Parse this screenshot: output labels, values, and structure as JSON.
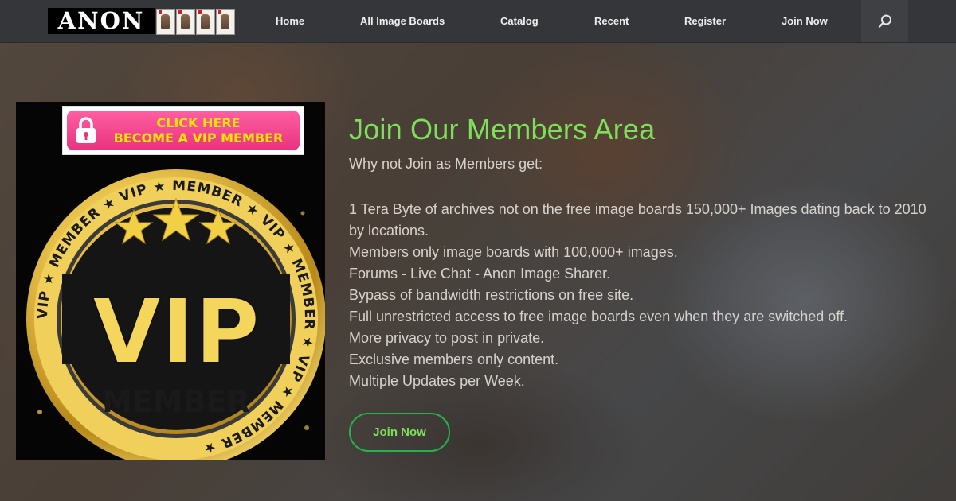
{
  "brand": {
    "logo_text": "ANON",
    "logo_cards_icon": "playing-cards-icon"
  },
  "nav": {
    "items": [
      {
        "label": "Home"
      },
      {
        "label": "All Image Boards"
      },
      {
        "label": "Catalog"
      },
      {
        "label": "Recent"
      },
      {
        "label": "Register"
      },
      {
        "label": "Join Now"
      }
    ],
    "search_icon": "search-icon"
  },
  "vip_image": {
    "banner_line1": "CLICK HERE",
    "banner_line2": "BECOME A VIP MEMBER",
    "badge_title": "VIP",
    "badge_subtitle": "MEMBER",
    "ring_text": "VIP ★ MEMBER ★ VIP ★ MEMBER ★ VIP ★ MEMBER ★ VIP ★ MEMBER ★ ",
    "lock_icon": "lock-icon",
    "star_icon": "star-icon"
  },
  "main": {
    "headline": "Join Our Members Area",
    "intro": "Why not Join as Members get:",
    "benefits": [
      "1 Tera Byte of archives not on the free image boards 150,000+ Images dating back to 2010 by locations.",
      "Members only image boards with 100,000+ images.",
      "Forums - Live Chat - Anon Image Sharer.",
      "Bypass of bandwidth restrictions on free site.",
      "Full unrestricted access to free image boards even when they are switched off.",
      "More privacy to post in private.",
      "Exclusive members only content.",
      "Multiple Updates per Week."
    ],
    "cta_label": "Join Now"
  },
  "colors": {
    "nav_bg": "#35363a",
    "accent_green": "#7ee05a",
    "button_border": "#24b34b",
    "gold": "#e8c24a",
    "banner_pink": "#e8337f",
    "banner_text": "#ffe600"
  }
}
